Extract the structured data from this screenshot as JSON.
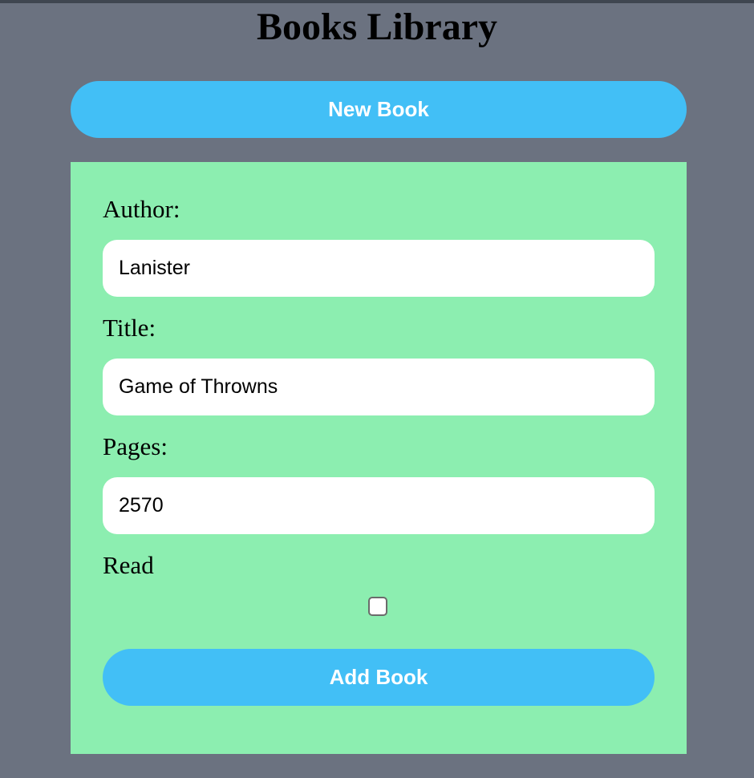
{
  "colors": {
    "page_background": "#6b7280",
    "panel_background": "#8ceeb0",
    "button_background": "#42bff6",
    "button_text": "#ffffff",
    "input_background": "#ffffff"
  },
  "header": {
    "title": "Books Library"
  },
  "toolbar": {
    "new_book_label": "New Book"
  },
  "form": {
    "author": {
      "label": "Author:",
      "value": "Lanister"
    },
    "title": {
      "label": "Title:",
      "value": "Game of Throwns"
    },
    "pages": {
      "label": "Pages:",
      "value": "2570"
    },
    "read": {
      "label": "Read",
      "checked": false
    },
    "submit_label": "Add Book"
  }
}
